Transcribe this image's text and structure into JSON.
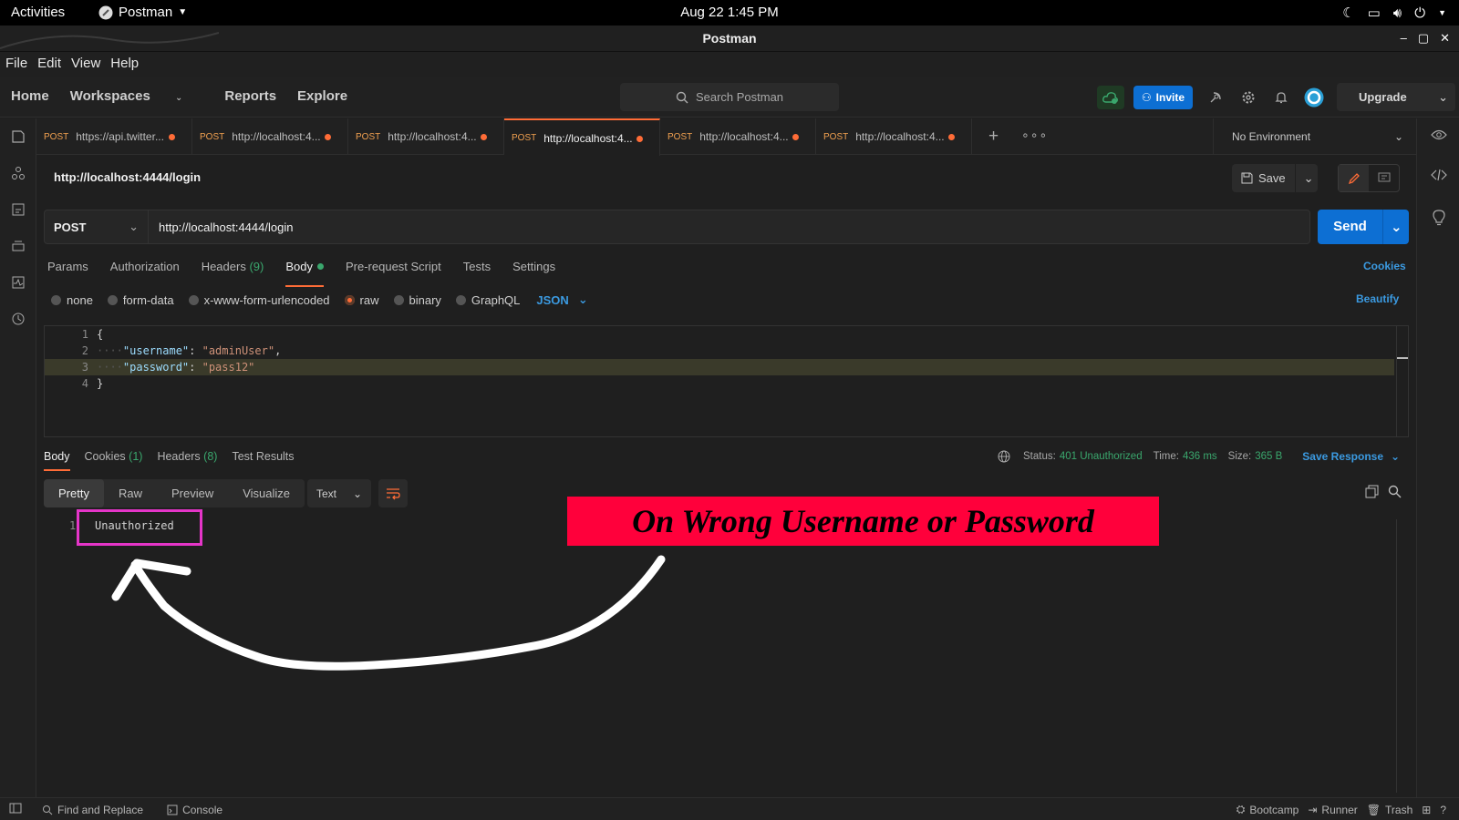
{
  "system_bar": {
    "activities": "Activities",
    "app_name": "Postman",
    "clock": "Aug 22  1:45 PM"
  },
  "window": {
    "title": "Postman"
  },
  "menu": [
    "File",
    "Edit",
    "View",
    "Help"
  ],
  "header": {
    "nav": [
      "Home",
      "Workspaces",
      "Reports",
      "Explore"
    ],
    "search_placeholder": "Search Postman",
    "invite": "Invite",
    "upgrade": "Upgrade"
  },
  "tabs": [
    {
      "method": "POST",
      "url": "https://api.twitter..."
    },
    {
      "method": "POST",
      "url": "http://localhost:4..."
    },
    {
      "method": "POST",
      "url": "http://localhost:4..."
    },
    {
      "method": "POST",
      "url": "http://localhost:4..."
    },
    {
      "method": "POST",
      "url": "http://localhost:4..."
    },
    {
      "method": "POST",
      "url": "http://localhost:4..."
    }
  ],
  "active_tab_index": 3,
  "environment": "No Environment",
  "request": {
    "title": "http://localhost:4444/login",
    "save": "Save",
    "method": "POST",
    "url": "http://localhost:4444/login",
    "send": "Send",
    "tabs": {
      "params": "Params",
      "authorization": "Authorization",
      "headers": "Headers",
      "headers_count": "(9)",
      "body": "Body",
      "pre_request": "Pre-request Script",
      "tests": "Tests",
      "settings": "Settings"
    },
    "cookies": "Cookies",
    "body_types": [
      "none",
      "form-data",
      "x-www-form-urlencoded",
      "raw",
      "binary",
      "GraphQL"
    ],
    "selected_body_type": "raw",
    "format": "JSON",
    "beautify": "Beautify",
    "body_lines": {
      "l1": "{",
      "l2_key": "\"username\"",
      "l2_val": "\"adminUser\"",
      "l3_key": "\"password\"",
      "l3_val": "\"pass12\"",
      "l4": "}"
    }
  },
  "response": {
    "tabs": {
      "body": "Body",
      "cookies": "Cookies",
      "cookies_count": "(1)",
      "headers": "Headers",
      "headers_count": "(8)",
      "test_results": "Test Results"
    },
    "status_label": "Status:",
    "status_value": "401 Unauthorized",
    "time_label": "Time:",
    "time_value": "436 ms",
    "size_label": "Size:",
    "size_value": "365 B",
    "save_response": "Save Response",
    "views": [
      "Pretty",
      "Raw",
      "Preview",
      "Visualize"
    ],
    "selected_view": "Pretty",
    "format": "Text",
    "body_text": "Unauthorized"
  },
  "annotation": {
    "banner": "On Wrong Username or Password"
  },
  "statusbar": {
    "find_replace": "Find and Replace",
    "console": "Console",
    "bootcamp": "Bootcamp",
    "runner": "Runner",
    "trash": "Trash"
  },
  "colors": {
    "accent_orange": "#ff6c37",
    "primary_blue": "#0d6fd3",
    "status_green": "#3aa76d",
    "annotation_red": "#ff003b",
    "annotation_magenta": "#e535c8"
  }
}
